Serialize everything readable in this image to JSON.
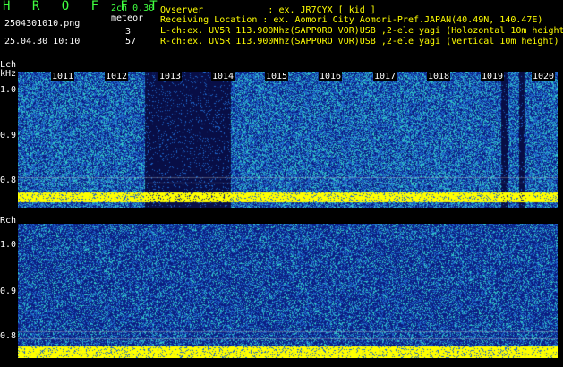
{
  "header": {
    "app_title": "H R O F F T",
    "mode": "2ch 0.30",
    "meteor_label": "meteor",
    "filename": "2504301010.png",
    "datetime": "25.04.30 10:10",
    "l_count": "3",
    "r_count": "57",
    "info_lines": [
      "Ovserver            : ex. JR7CYX [ kid ]",
      "Receiving Location : ex. Aomori City Aomori-Pref.JAPAN(40.49N, 140.47E)",
      "L-ch:ex. UV5R 113.900Mhz(SAPPORO VOR)USB ,2-ele yagi (Holozontal 10m height)",
      "R-ch:ex. UV5R 113.900Mhz(SAPPORO VOR)USB ,2-ele yagi (Vertical 10m height)"
    ]
  },
  "lch": {
    "label": "Lch",
    "unit": "kHz",
    "ticks": [
      "1.0",
      "0.9",
      "0.8"
    ],
    "time_labels": [
      "1011",
      "1012",
      "1013",
      "1014",
      "1015",
      "1016",
      "1017",
      "1018",
      "1019",
      "1020"
    ]
  },
  "rch": {
    "label": "Rch",
    "ticks": [
      "1.0",
      "0.9",
      "0.8"
    ]
  },
  "colors": {
    "background": "#000000",
    "noise_dark": "#0b1d82",
    "noise_mid": "#1e64c8",
    "noise_light": "#32c8c8",
    "carrier": "#ffff00",
    "text_yellow": "#ffff00",
    "text_green": "#40ff40"
  }
}
